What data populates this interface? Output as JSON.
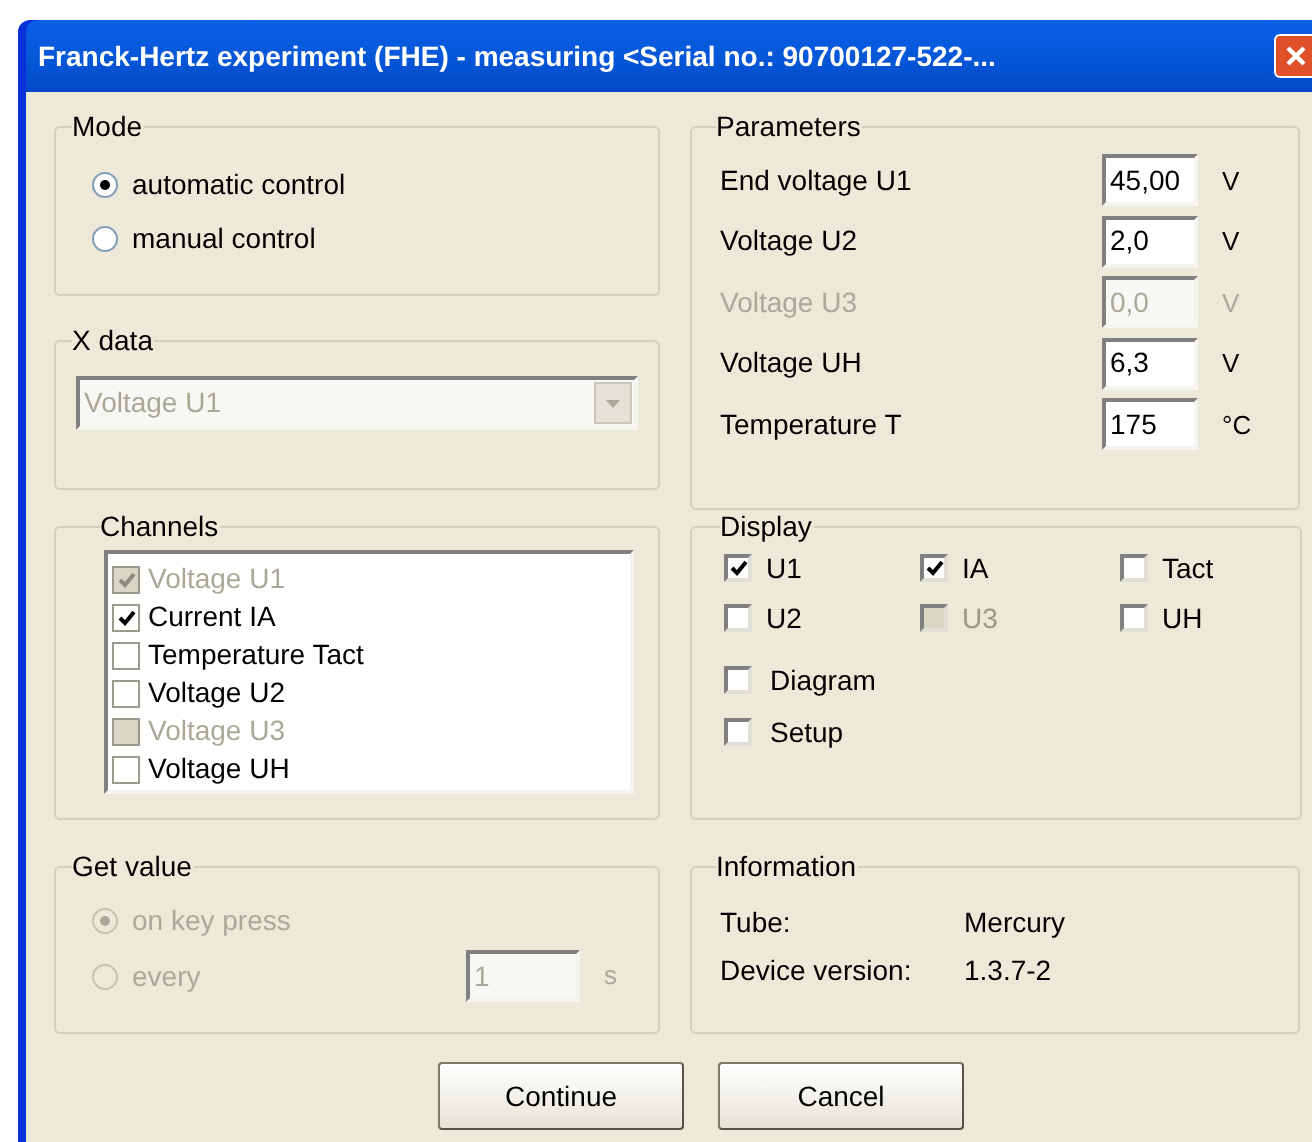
{
  "window": {
    "title": "Franck-Hertz experiment (FHE) - measuring  <Serial no.: 90700127-522-..."
  },
  "mode": {
    "label": "Mode",
    "options": [
      {
        "label": "automatic control",
        "selected": true
      },
      {
        "label": "manual control",
        "selected": false
      }
    ]
  },
  "x_data": {
    "label": "X data",
    "value": "Voltage U1",
    "disabled": true
  },
  "channels": {
    "label": "Channels",
    "items": [
      {
        "label": "Voltage U1",
        "checked": true,
        "disabled": true
      },
      {
        "label": "Current IA",
        "checked": true,
        "disabled": false
      },
      {
        "label": "Temperature Tact",
        "checked": false,
        "disabled": false
      },
      {
        "label": "Voltage U2",
        "checked": false,
        "disabled": false
      },
      {
        "label": "Voltage U3",
        "checked": false,
        "disabled": true
      },
      {
        "label": "Voltage UH",
        "checked": false,
        "disabled": false
      }
    ]
  },
  "get_value": {
    "label": "Get value",
    "disabled": true,
    "options": [
      {
        "label": "on key press",
        "selected": true
      },
      {
        "label": "every",
        "selected": false
      }
    ],
    "interval": {
      "value": "1",
      "unit": "s"
    }
  },
  "parameters": {
    "label": "Parameters",
    "rows": [
      {
        "label": "End voltage U1",
        "value": "45,00",
        "unit": "V",
        "disabled": false
      },
      {
        "label": "Voltage U2",
        "value": "2,0",
        "unit": "V",
        "disabled": false
      },
      {
        "label": "Voltage U3",
        "value": "0,0",
        "unit": "V",
        "disabled": true
      },
      {
        "label": "Voltage UH",
        "value": "6,3",
        "unit": "V",
        "disabled": false
      },
      {
        "label": "Temperature T",
        "value": "175",
        "unit": "°C",
        "disabled": false
      }
    ]
  },
  "display": {
    "label": "Display",
    "grid": [
      {
        "label": "U1",
        "checked": true,
        "disabled": false
      },
      {
        "label": "IA",
        "checked": true,
        "disabled": false
      },
      {
        "label": "Tact",
        "checked": false,
        "disabled": false
      },
      {
        "label": "U2",
        "checked": false,
        "disabled": false
      },
      {
        "label": "U3",
        "checked": false,
        "disabled": true
      },
      {
        "label": "UH",
        "checked": false,
        "disabled": false
      }
    ],
    "options": [
      {
        "label": "Diagram",
        "checked": false,
        "disabled": false
      },
      {
        "label": "Setup",
        "checked": false,
        "disabled": false
      }
    ]
  },
  "information": {
    "label": "Information",
    "rows": [
      {
        "label": "Tube:",
        "value": "Mercury"
      },
      {
        "label": "Device version:",
        "value": "1.3.7-2"
      }
    ]
  },
  "buttons": [
    "Continue",
    "Cancel"
  ]
}
